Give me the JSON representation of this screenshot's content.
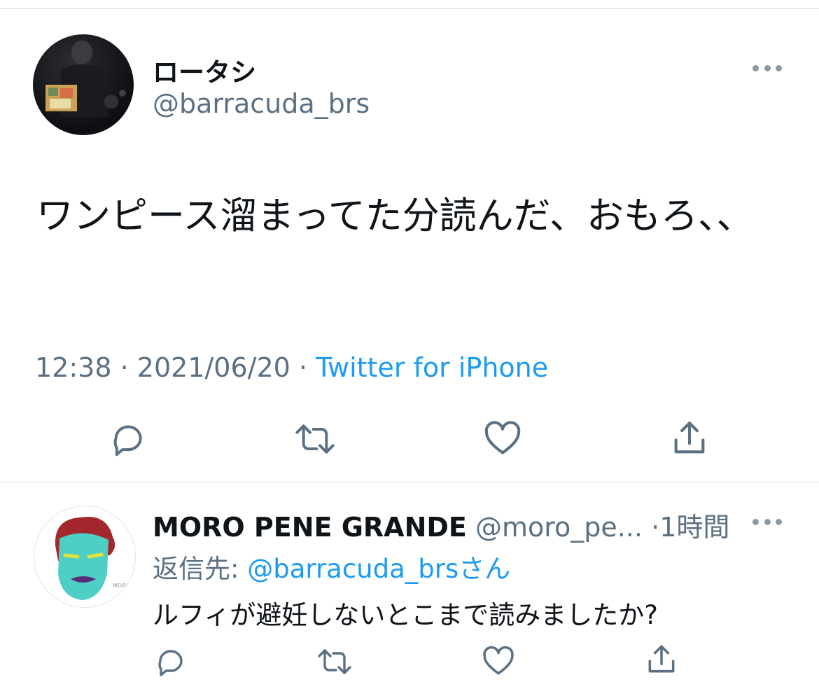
{
  "tweet": {
    "display_name": "ロータシ",
    "handle": "@barracuda_brs",
    "text": "ワンピース溜まってた分読んだ、おもろ、、",
    "time": "12:38",
    "date": "2021/06/20",
    "separator": "·",
    "source": "Twitter for iPhone",
    "actions": [
      "reply-icon",
      "retweet-icon",
      "like-icon",
      "share-icon"
    ]
  },
  "reply": {
    "display_name": "MORO PENE GRANDE",
    "handle": "@moro_pe...",
    "separator": "·",
    "time": "1時間",
    "replying_label": "返信先: ",
    "replying_to": "@barracuda_brs",
    "replying_suffix": "さん",
    "text": "ルフィが避妊しないとこまで読みましたか?",
    "actions": [
      "reply-icon",
      "retweet-icon",
      "like-icon",
      "share-icon"
    ]
  },
  "colors": {
    "text_primary": "#0f1419",
    "text_secondary": "#5b7083",
    "link": "#1d9bf0",
    "divider": "#d8dde2"
  }
}
